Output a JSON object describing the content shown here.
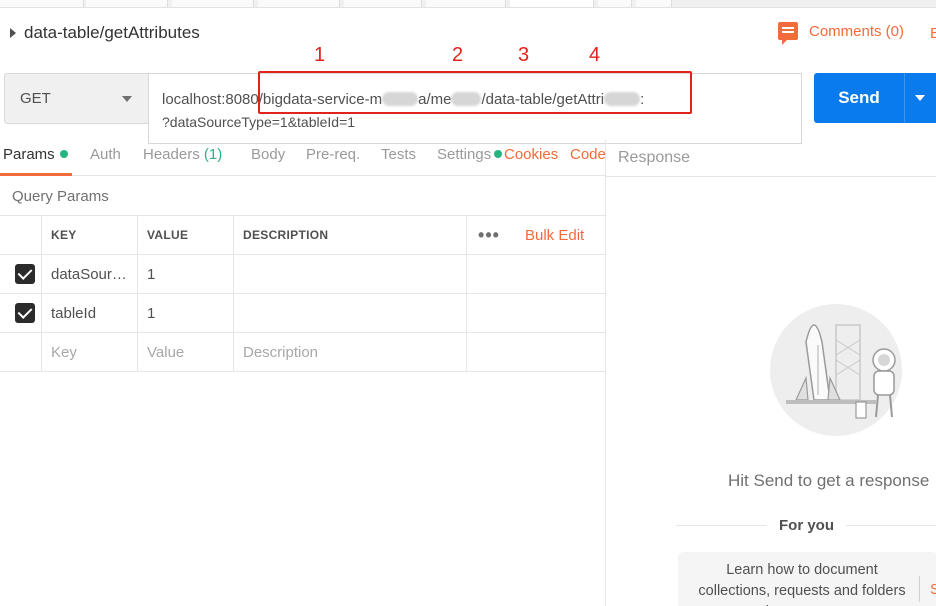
{
  "request": {
    "name": "data-table/getAttributes",
    "method": "GET",
    "url_line1_a": "localhost:8080/bigdata-service-m",
    "url_line1_b": "a/me",
    "url_line1_c": "/data-table/getAttri",
    "url_line1_d": ":",
    "url_line2": "?dataSourceType=1&tableId=1",
    "send_label": "Send"
  },
  "comments": {
    "label": "Comments (0)",
    "edge_label": "E"
  },
  "annotations": [
    "1",
    "2",
    "3",
    "4"
  ],
  "tabs": {
    "params": "Params",
    "auth": "Auth",
    "headers": "Headers",
    "headers_count": "(1)",
    "body": "Body",
    "prereq": "Pre-req.",
    "tests": "Tests",
    "settings": "Settings",
    "cookies": "Cookies",
    "code": "Code"
  },
  "query_params": {
    "title": "Query Params",
    "headers": {
      "key": "KEY",
      "value": "VALUE",
      "description": "DESCRIPTION",
      "more": "•••",
      "bulk_edit": "Bulk Edit"
    },
    "rows": [
      {
        "key": "dataSour…",
        "value": "1",
        "description": "",
        "checked": true
      },
      {
        "key": "tableId",
        "value": "1",
        "description": "",
        "checked": true
      }
    ],
    "placeholder": {
      "key": "Key",
      "value": "Value",
      "description": "Description"
    }
  },
  "response": {
    "title": "Response",
    "empty_message": "Hit Send to get a response",
    "for_you": "For you",
    "learn_text": "Learn how to document collections, requests and folders in Postman",
    "learn_side": "S"
  },
  "colors": {
    "accent": "#f26b3a",
    "send_blue": "#097bed",
    "status_green": "#26b47f",
    "annotation_red": "#e0241b"
  },
  "icons": {
    "expand": "caret-right-icon",
    "comments": "comment-icon",
    "method_dropdown": "chevron-down-icon",
    "send_dropdown": "chevron-down-icon",
    "checkbox": "checkbox-checked-icon",
    "illustration": "rocket-astronaut-illustration"
  }
}
